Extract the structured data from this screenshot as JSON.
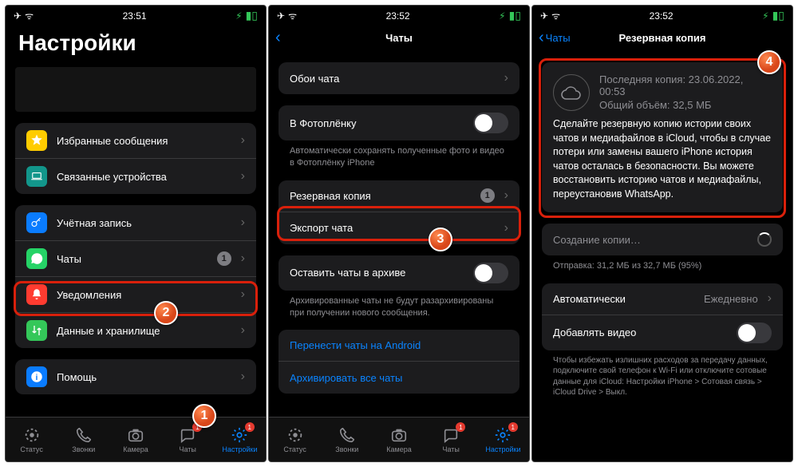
{
  "status": {
    "time1": "23:51",
    "time2": "23:52",
    "time3": "23:52"
  },
  "p1": {
    "title": "Настройки",
    "items1": [
      {
        "icon": "star",
        "bg": "#ffcc00",
        "label": "Избранные сообщения"
      },
      {
        "icon": "laptop",
        "bg": "#12968b",
        "label": "Связанные устройства"
      }
    ],
    "items2": [
      {
        "icon": "key",
        "bg": "#0a7cff",
        "label": "Учётная запись"
      },
      {
        "icon": "wa",
        "bg": "#25d366",
        "label": "Чаты",
        "badge": "1"
      },
      {
        "icon": "bell",
        "bg": "#ff3b30",
        "label": "Уведомления"
      },
      {
        "icon": "arrows",
        "bg": "#34c759",
        "label": "Данные и хранилище"
      }
    ],
    "items3": [
      {
        "icon": "info",
        "bg": "#0a7cff",
        "label": "Помощь"
      }
    ]
  },
  "p2": {
    "back": "",
    "title": "Чаты",
    "g1": [
      {
        "label": "Обои чата"
      }
    ],
    "g2_label": "В Фотоплёнку",
    "g2_foot": "Автоматически сохранять полученные фото и видео в Фотоплёнку iPhone",
    "g3": [
      {
        "label": "Резервная копия",
        "badge": "1"
      },
      {
        "label": "Экспорт чата"
      }
    ],
    "g4_label": "Оставить чаты в архиве",
    "g4_foot": "Архивированные чаты не будут разархивированы при получении нового сообщения.",
    "g5": [
      {
        "label": "Перенести чаты на Android",
        "link": true
      },
      {
        "label": "Архивировать все чаты",
        "link": true
      }
    ]
  },
  "p3": {
    "back": "Чаты",
    "title": "Резервная копия",
    "last_label": "Последняя копия: 23.06.2022, 00:53",
    "size_label": "Общий объём: 32,5 МБ",
    "desc": "Сделайте резервную копию истории своих чатов и медиафайлов в iCloud, чтобы в случае потери или замены вашего iPhone история чатов осталась в безопасности. Вы можете восстановить историю чатов и медиафайлы, переустановив WhatsApp.",
    "creating": "Создание копии…",
    "progress": "Отправка: 31,2 МБ из 32,7 МБ (95%)",
    "auto_label": "Автоматически",
    "auto_value": "Ежедневно",
    "video_label": "Добавлять видео",
    "foot": "Чтобы избежать излишних расходов за передачу данных, подключите свой телефон к Wi-Fi или отключите сотовые данные для iCloud: Настройки iPhone > Сотовая связь > iCloud Drive > Выкл."
  },
  "tabs": {
    "status": "Статус",
    "calls": "Звонки",
    "camera": "Камера",
    "chats": "Чаты",
    "settings": "Настройки",
    "chats_badge": "1",
    "settings_badge": "1"
  }
}
